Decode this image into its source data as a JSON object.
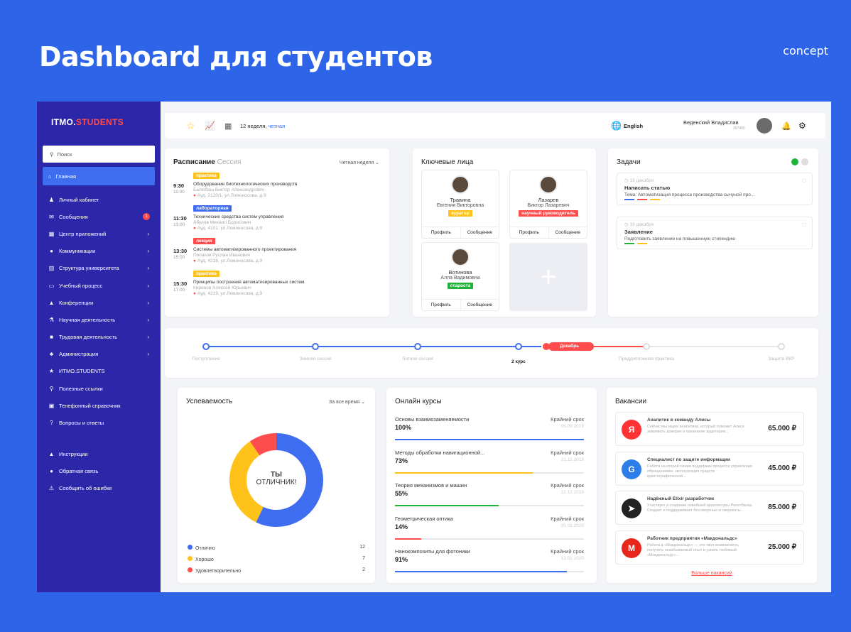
{
  "hero": {
    "title": "Dashboard для студентов",
    "tag": "concept"
  },
  "colors": {
    "brand": "#2d64e8",
    "sidebar": "#2c27a8",
    "accent_red": "#ff4c4c",
    "blue": "#3f6df0",
    "yellow": "#ffc21a",
    "green": "#1fb33a"
  },
  "sidebar": {
    "logo_main": "ITMO.",
    "logo_accent": "STUDENTS",
    "search_placeholder": "Поиск",
    "home": "Главная",
    "items": [
      {
        "icon": "user-icon",
        "label": "Личный кабинет",
        "chevron": false,
        "badge": ""
      },
      {
        "icon": "mail-icon",
        "label": "Сообщения",
        "chevron": false,
        "badge": "1"
      },
      {
        "icon": "grid-icon",
        "label": "Центр приложений",
        "chevron": true,
        "badge": ""
      },
      {
        "icon": "chat-icon",
        "label": "Коммуникации",
        "chevron": true,
        "badge": ""
      },
      {
        "icon": "building-icon",
        "label": "Структура университета",
        "chevron": true,
        "badge": ""
      },
      {
        "icon": "board-icon",
        "label": "Учебный процесс",
        "chevron": true,
        "badge": ""
      },
      {
        "icon": "podium-icon",
        "label": "Конференции",
        "chevron": true,
        "badge": ""
      },
      {
        "icon": "flask-icon",
        "label": "Научная деятельность",
        "chevron": true,
        "badge": ""
      },
      {
        "icon": "briefcase-icon",
        "label": "Трудовая деятельность",
        "chevron": true,
        "badge": ""
      },
      {
        "icon": "group-icon",
        "label": "Администрация",
        "chevron": true,
        "badge": ""
      },
      {
        "icon": "star-icon",
        "label": "ИТМО.STUDENTS",
        "chevron": false,
        "badge": ""
      },
      {
        "icon": "link-icon",
        "label": "Полезные ссылки",
        "chevron": false,
        "badge": ""
      },
      {
        "icon": "phone-book-icon",
        "label": "Телефонный справочник",
        "chevron": false,
        "badge": ""
      },
      {
        "icon": "question-icon",
        "label": "Вопросы и ответы",
        "chevron": false,
        "badge": ""
      }
    ],
    "bottom": [
      {
        "icon": "instructions-icon",
        "label": "Инструкции"
      },
      {
        "icon": "feedback-icon",
        "label": "Обратная связь"
      },
      {
        "icon": "warning-icon",
        "label": "Сообщить об ошибке"
      }
    ]
  },
  "topbar": {
    "week": "12 неделя,",
    "week_type": "четная",
    "language": "English",
    "user": "Веденский Владислав",
    "user_id": "367455"
  },
  "schedule": {
    "title": "Расписание",
    "tab2": "Сессия",
    "filter": "Четная неделя",
    "rows": [
      {
        "start": "9:30",
        "end": "11:00",
        "tag": "практика",
        "tag_color": "#ffc21a",
        "subject": "Оборудование биотехнологических производств",
        "teacher": "Балюбаш Виктор Александрович",
        "room": "Ауд. 2120/1, ул.Ломоносова, д.9"
      },
      {
        "start": "11:30",
        "end": "13:00",
        "tag": "лабораторная",
        "tag_color": "#3f6df0",
        "subject": "Технические средства систем управления",
        "teacher": "Абулов Михаил Борисович",
        "room": "Ауд. 4101, ул.Ломоносова, д.9"
      },
      {
        "start": "13:30",
        "end": "15:00",
        "tag": "лекция",
        "tag_color": "#ff4c4c",
        "subject": "Системы автоматизированного проектирования",
        "teacher": "Попаков Руслан Иванович",
        "room": "Ауд. 4218, ул.Ломоносова, д.9"
      },
      {
        "start": "15:30",
        "end": "17:00",
        "tag": "практика",
        "tag_color": "#ffc21a",
        "subject": "Принципы построения автоматизированных систем",
        "teacher": "Киринов Алексей Юрьевич",
        "room": "Ауд. 4219, ул.Ломоносова, д.9"
      }
    ]
  },
  "people": {
    "title": "Ключевые лица",
    "profile": "Профиль",
    "message": "Сообщение",
    "list": [
      {
        "last": "Травина",
        "first": "Евгения Викторовна",
        "role": "куратор",
        "role_color": "#ffc21a"
      },
      {
        "last": "Лазарев",
        "first": "Виктор Лазаревич",
        "role": "научный руководитель",
        "role_color": "#ff4c4c"
      },
      {
        "last": "Вотинова",
        "first": "Алла Вадимовна",
        "role": "староста",
        "role_color": "#1fb33a"
      }
    ]
  },
  "tasks": {
    "title": "Задачи",
    "list": [
      {
        "date": "19 декабря",
        "title": "Написать статью",
        "desc": "Тема: Автоматизация процесса производства сычуной про..."
      },
      {
        "date": "19 декабря",
        "title": "Заявление",
        "desc": "Подготовить заявление на повышенную стипендию"
      }
    ]
  },
  "timeline": {
    "labels": [
      "Поступление",
      "Зимняя сессия",
      "Летняя сессия",
      "2 курс",
      "Преддипломная практика",
      "Защита ВКР"
    ],
    "current": "Декабрь"
  },
  "performance": {
    "title": "Успеваемость",
    "filter": "За все время",
    "center_1": "ТЫ",
    "center_2": "ОТЛИЧНИК!",
    "legend": [
      {
        "label": "Отлично",
        "value": 12,
        "color": "#3f6df0"
      },
      {
        "label": "Хорошо",
        "value": 7,
        "color": "#ffc21a"
      },
      {
        "label": "Удовлетворительно",
        "value": 2,
        "color": "#ff4c4c"
      }
    ]
  },
  "courses": {
    "title": "Онлайн курсы",
    "deadline_label": "Крайний срок",
    "list": [
      {
        "name": "Основы взаимозаменяемости",
        "percent": 100,
        "percent_label": "100%",
        "date": "05.09.2019",
        "color": "#3f6df0"
      },
      {
        "name": "Методы обработки навигационной...",
        "percent": 73,
        "percent_label": "73%",
        "date": "21.11.2019",
        "color": "#ffc21a"
      },
      {
        "name": "Теория механизмов и машин",
        "percent": 55,
        "percent_label": "55%",
        "date": "12.12.2019",
        "color": "#1fb33a"
      },
      {
        "name": "Геометрическая оптика",
        "percent": 14,
        "percent_label": "14%",
        "date": "05.01.2020",
        "color": "#ff4c4c"
      },
      {
        "name": "Нанокомпозиты для фотоники",
        "percent": 91,
        "percent_label": "91%",
        "date": "13.01.2020",
        "color": "#3f6df0"
      }
    ]
  },
  "vacancies": {
    "title": "Вакансии",
    "more": "Больше вакансий",
    "list": [
      {
        "logo": "yandex-logo",
        "logo_char": "Я",
        "logo_color": "#ff3333",
        "title": "Аналитик в команду Алисы",
        "desc": "Сейчас мы ищем аналитика, который поможет Алисе завоевать доверие и признание аудитории...",
        "salary": "65.000 ₽"
      },
      {
        "logo": "rostelecom-logo",
        "logo_char": "G",
        "logo_color": "#2d7ee8",
        "title": "Специалист по защите информации",
        "desc": "Работа на второй линии поддержки процесса управления обращениями, эксплуатация средств криптографической...",
        "salary": "45.000 ₽"
      },
      {
        "logo": "telegram-logo",
        "logo_char": "➤",
        "logo_color": "#222222",
        "title": "Надёжный Elixir разработчик",
        "desc": "Участвует в создании новейшей архитектуры Ронетбанка. Создает и поддерживает бессмертные и сверхкоты...",
        "salary": "85.000 ₽"
      },
      {
        "logo": "mcdonalds-logo",
        "logo_char": "M",
        "logo_color": "#e8261c",
        "title": "Работник предприятия «Макдональдс»",
        "desc": "Работа в «Макдональдс» — это твоя возможность получить незабываемый опыт и узнать любимый «Макдональдс»...",
        "salary": "25.000 ₽"
      }
    ]
  }
}
